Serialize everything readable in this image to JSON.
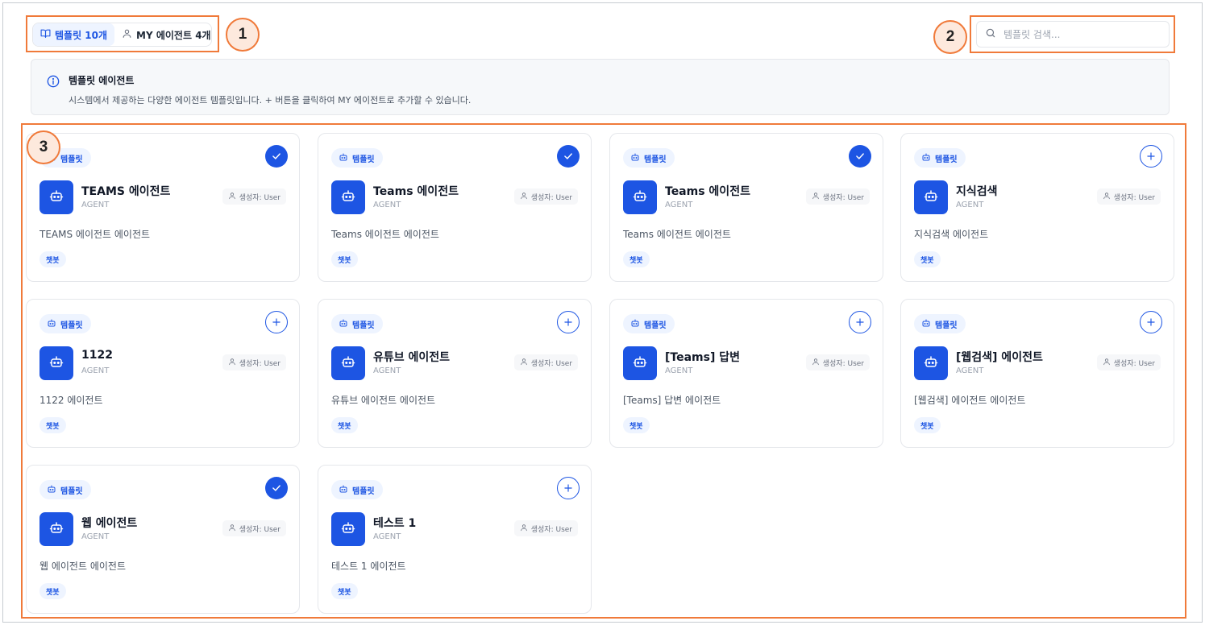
{
  "tabs": {
    "template_label": "템플릿 10개",
    "my_agents_label": "MY 에이전트 4개"
  },
  "search": {
    "placeholder": "템플릿 검색..."
  },
  "info": {
    "title": "템플릿 에이전트",
    "description": "시스템에서 제공하는 다양한 에이전트 템플릿입니다. + 버튼을 클릭하여 MY 에이전트로 추가할 수 있습니다."
  },
  "callouts": [
    "1",
    "2",
    "3"
  ],
  "colors": {
    "accent": "#1d55e3",
    "callout_border": "#f07a3a"
  },
  "cards": [
    {
      "badge": "템플릿",
      "name": "TEAMS 에이전트",
      "type": "AGENT",
      "creator": "생성자: User",
      "description": "TEAMS 에이전트 에이전트",
      "tag": "챗봇",
      "added": true
    },
    {
      "badge": "템플릿",
      "name": "Teams 에이전트",
      "type": "AGENT",
      "creator": "생성자: User",
      "description": "Teams 에이전트 에이전트",
      "tag": "챗봇",
      "added": true
    },
    {
      "badge": "템플릿",
      "name": "Teams 에이전트",
      "type": "AGENT",
      "creator": "생성자: User",
      "description": "Teams 에이전트 에이전트",
      "tag": "챗봇",
      "added": true
    },
    {
      "badge": "템플릿",
      "name": "지식검색",
      "type": "AGENT",
      "creator": "생성자: User",
      "description": "지식검색 에이전트",
      "tag": "챗봇",
      "added": false
    },
    {
      "badge": "템플릿",
      "name": "1122",
      "type": "AGENT",
      "creator": "생성자: User",
      "description": "1122 에이전트",
      "tag": "챗봇",
      "added": false
    },
    {
      "badge": "템플릿",
      "name": "유튜브 에이전트",
      "type": "AGENT",
      "creator": "생성자: User",
      "description": "유튜브 에이전트 에이전트",
      "tag": "챗봇",
      "added": false
    },
    {
      "badge": "템플릿",
      "name": "[Teams] 답변",
      "type": "AGENT",
      "creator": "생성자: User",
      "description": "[Teams] 답변 에이전트",
      "tag": "챗봇",
      "added": false
    },
    {
      "badge": "템플릿",
      "name": "[웹검색] 에이전트",
      "type": "AGENT",
      "creator": "생성자: User",
      "description": "[웹검색] 에이전트 에이전트",
      "tag": "챗봇",
      "added": false
    },
    {
      "badge": "템플릿",
      "name": "웹 에이전트",
      "type": "AGENT",
      "creator": "생성자: User",
      "description": "웹 에이전트 에이전트",
      "tag": "챗봇",
      "added": true
    },
    {
      "badge": "템플릿",
      "name": "테스트 1",
      "type": "AGENT",
      "creator": "생성자: User",
      "description": "테스트 1 에이전트",
      "tag": "챗봇",
      "added": false
    }
  ]
}
